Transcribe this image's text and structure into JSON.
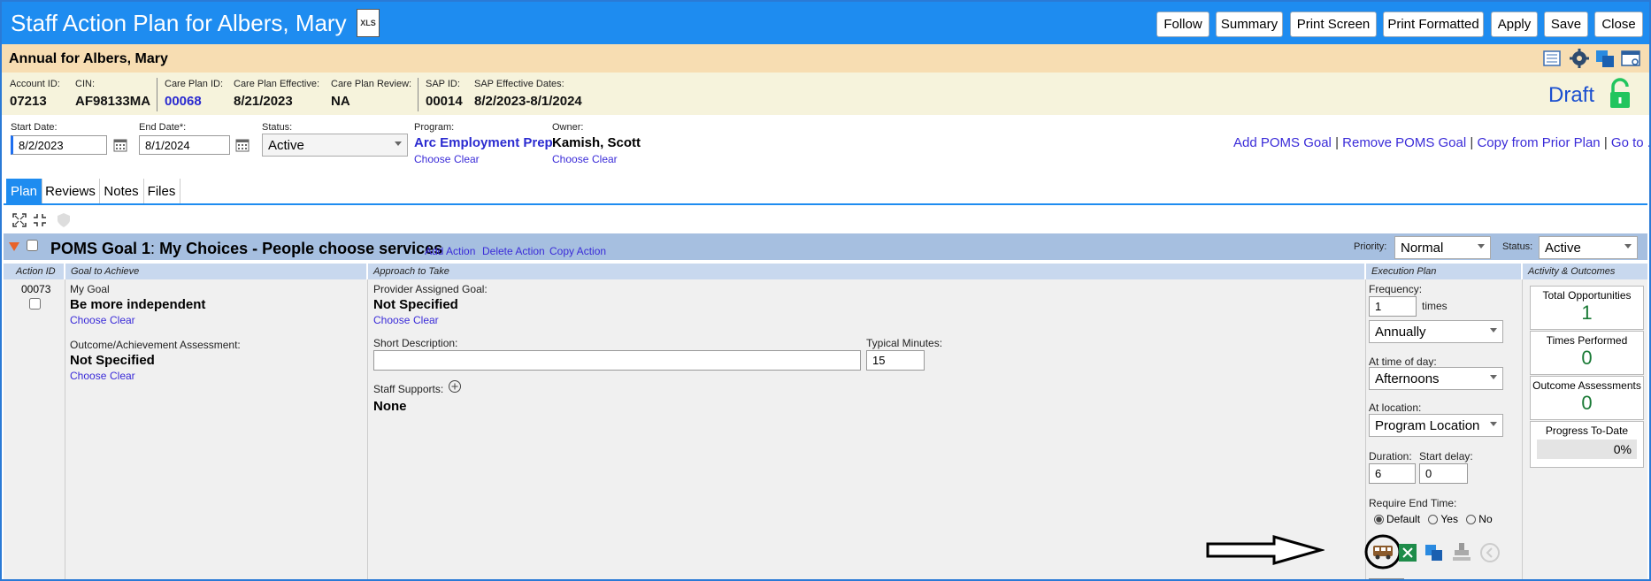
{
  "window": {
    "title": "Staff Action Plan for Albers, Mary",
    "xls_label": "XLS",
    "buttons": [
      "Follow",
      "Summary",
      "Print Screen",
      "Print Formatted",
      "Apply",
      "Save",
      "Close"
    ]
  },
  "subheader": {
    "title": "Annual for Albers, Mary"
  },
  "info": {
    "account_id_label": "Account ID:",
    "account_id": "07213",
    "cin_label": "CIN:",
    "cin": "AF98133MA",
    "care_plan_id_label": "Care Plan ID:",
    "care_plan_id": "00068",
    "care_plan_effective_label": "Care Plan Effective:",
    "care_plan_effective": "8/21/2023",
    "care_plan_review_label": "Care Plan Review:",
    "care_plan_review": "NA",
    "sap_id_label": "SAP ID:",
    "sap_id": "00014",
    "sap_effective_label": "SAP Effective Dates:",
    "sap_effective": "8/2/2023-8/1/2024",
    "status": "Draft"
  },
  "form": {
    "start_date_label": "Start Date:",
    "start_date": "8/2/2023",
    "end_date_label": "End Date*:",
    "end_date": "8/1/2024",
    "status_label": "Status:",
    "status": "Active",
    "program_label": "Program:",
    "program": "Arc Employment Prep",
    "owner_label": "Owner:",
    "owner": "Kamish, Scott",
    "choose": "Choose",
    "clear": "Clear",
    "actions": [
      "Add POMS Goal",
      "Remove POMS Goal",
      "Copy from Prior Plan",
      "Go to ..."
    ],
    "sep": "|"
  },
  "tabs": [
    "Plan",
    "Reviews",
    "Notes",
    "Files"
  ],
  "goal": {
    "title": "POMS Goal 1",
    "subtitle": "My Choices - People choose services",
    "sep": ":",
    "actions": [
      "Add Action",
      "Delete Action",
      "Copy Action"
    ],
    "priority_label": "Priority:",
    "priority": "Normal",
    "status_label": "Status:",
    "status": "Active"
  },
  "columns": [
    "Action ID",
    "Goal to Achieve",
    "Approach to Take",
    "Execution Plan",
    "Activity & Outcomes"
  ],
  "action": {
    "id": "00073",
    "my_goal_label": "My Goal",
    "my_goal": "Be more independent",
    "outcome_label": "Outcome/Achievement Assessment:",
    "outcome": "Not Specified",
    "provider_goal_label": "Provider Assigned Goal:",
    "provider_goal": "Not Specified",
    "short_desc_label": "Short Description:",
    "short_desc": "",
    "typical_minutes_label": "Typical Minutes:",
    "typical_minutes": "15",
    "staff_supports_label": "Staff Supports:",
    "staff_supports": "None"
  },
  "execution": {
    "frequency_label": "Frequency:",
    "frequency": "1",
    "times": "times",
    "period": "Annually",
    "time_of_day_label": "At time of day:",
    "time_of_day": "Afternoons",
    "location_label": "At location:",
    "location": "Program Location",
    "duration_label": "Duration:",
    "duration": "6",
    "start_delay_label": "Start delay:",
    "start_delay": "0",
    "require_end_label": "Require End Time:",
    "options": [
      "Default",
      "Yes",
      "No"
    ],
    "selected": "Default"
  },
  "activity": {
    "total_label": "Total Opportunities",
    "total": "1",
    "performed_label": "Times Performed",
    "performed": "0",
    "assessments_label": "Outcome Assessments",
    "assessments": "0",
    "progress_label": "Progress To-Date",
    "progress": "0%"
  },
  "colors": {
    "titlebar": "#1e8cf0",
    "subheader": "#f7ddb2",
    "info": "#f6f3dc",
    "goalbar": "#a6bfe0",
    "link": "#3a2bd8",
    "lock": "#22c55e"
  }
}
